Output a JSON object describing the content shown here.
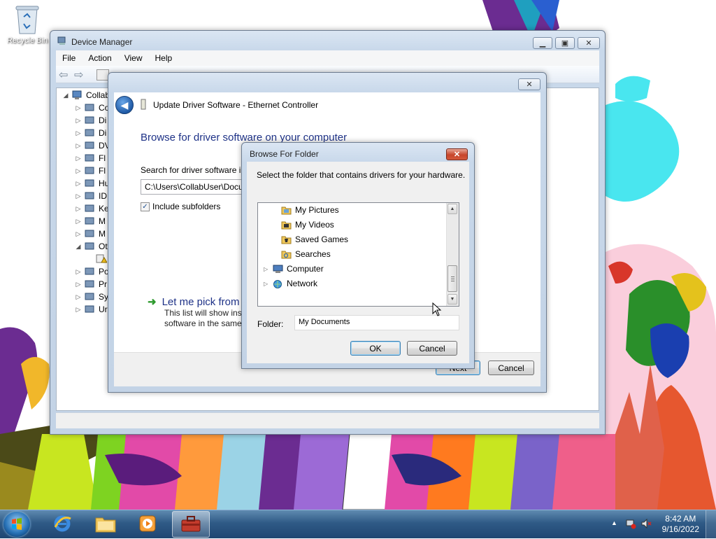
{
  "desktop": {
    "recycle_bin_label": "Recycle Bin"
  },
  "device_manager": {
    "title": "Device Manager",
    "menu": [
      "File",
      "Action",
      "View",
      "Help"
    ],
    "tree_root": "Collab",
    "tree_items": [
      "Co",
      "Di",
      "Di",
      "DV",
      "Fl",
      "Fl",
      "Hu",
      "ID",
      "Ke",
      "M",
      "M",
      "Ot",
      "",
      "Po",
      "Pr",
      "Sy",
      "Ur"
    ]
  },
  "update_driver": {
    "title": "Update Driver Software - Ethernet Controller",
    "heading": "Browse for driver software on your computer",
    "search_label": "Search for driver software in",
    "path_value": "C:\\Users\\CollabUser\\Docu",
    "include_subfolders_label": "Include subfolders",
    "include_subfolders_checked": true,
    "pick_heading": "Let me pick from",
    "pick_desc_line1": "This list will show inst",
    "pick_desc_line2": "software in the same",
    "next_label": "Next",
    "cancel_label": "Cancel"
  },
  "browse_folder": {
    "title": "Browse For Folder",
    "prompt": "Select the folder that contains drivers for your hardware.",
    "items": [
      {
        "label": "My Pictures",
        "indent": 1,
        "expandable": false,
        "icon": "pictures-folder-icon"
      },
      {
        "label": "My Videos",
        "indent": 1,
        "expandable": false,
        "icon": "videos-folder-icon"
      },
      {
        "label": "Saved Games",
        "indent": 1,
        "expandable": false,
        "icon": "saved-games-folder-icon"
      },
      {
        "label": "Searches",
        "indent": 1,
        "expandable": false,
        "icon": "searches-folder-icon"
      },
      {
        "label": "Computer",
        "indent": 0,
        "expandable": true,
        "icon": "computer-icon"
      },
      {
        "label": "Network",
        "indent": 0,
        "expandable": true,
        "icon": "network-icon"
      }
    ],
    "folder_label": "Folder:",
    "folder_value": "My Documents",
    "ok_label": "OK",
    "cancel_label": "Cancel"
  },
  "taskbar": {
    "time": "8:42 AM",
    "date": "9/16/2022",
    "pinned": [
      "internet-explorer-icon",
      "file-explorer-icon",
      "media-player-icon",
      "device-manager-icon"
    ]
  }
}
